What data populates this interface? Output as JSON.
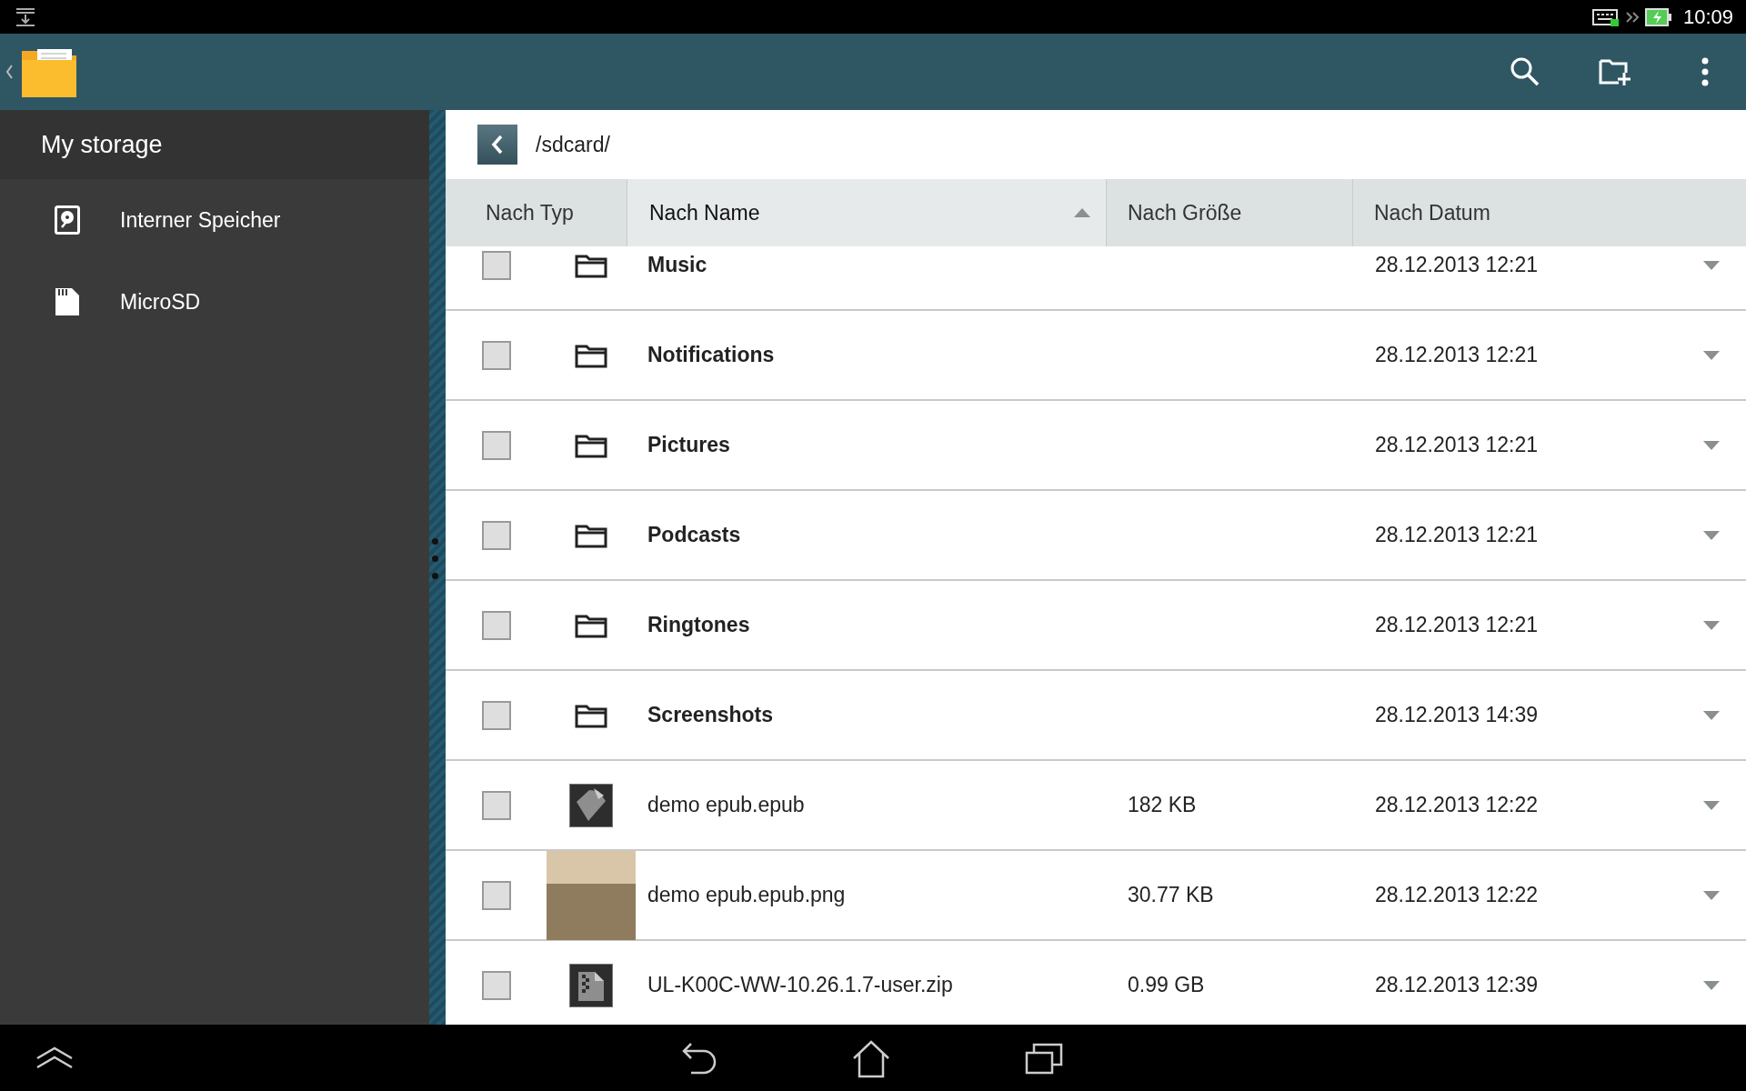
{
  "status_bar": {
    "time": "10:09"
  },
  "sidebar": {
    "title": "My storage",
    "items": [
      {
        "label": "Interner Speicher",
        "kind": "internal"
      },
      {
        "label": "MicroSD",
        "kind": "card"
      }
    ]
  },
  "path_bar": {
    "path": "/sdcard/"
  },
  "table": {
    "columns": [
      {
        "label": "Nach Typ",
        "selected": false
      },
      {
        "label": "Nach Name",
        "selected": true
      },
      {
        "label": "Nach Größe",
        "selected": false
      },
      {
        "label": "Nach Datum",
        "selected": false
      }
    ],
    "rows": [
      {
        "kind": "folder",
        "name": "Music",
        "size": "",
        "date": "28.12.2013 12:21",
        "checked": false
      },
      {
        "kind": "folder",
        "name": "Notifications",
        "size": "",
        "date": "28.12.2013 12:21",
        "checked": false
      },
      {
        "kind": "folder",
        "name": "Pictures",
        "size": "",
        "date": "28.12.2013 12:21",
        "checked": false
      },
      {
        "kind": "folder",
        "name": "Podcasts",
        "size": "",
        "date": "28.12.2013 12:21",
        "checked": false
      },
      {
        "kind": "folder",
        "name": "Ringtones",
        "size": "",
        "date": "28.12.2013 12:21",
        "checked": false
      },
      {
        "kind": "folder",
        "name": "Screenshots",
        "size": "",
        "date": "28.12.2013 14:39",
        "checked": false
      },
      {
        "kind": "document",
        "name": "demo epub.epub",
        "size": "182 KB",
        "date": "28.12.2013 12:22",
        "checked": false
      },
      {
        "kind": "image",
        "name": "demo epub.epub.png",
        "size": "30.77 KB",
        "date": "28.12.2013 12:22",
        "checked": false
      },
      {
        "kind": "archive",
        "name": "UL-K00C-WW-10.26.1.7-user.zip",
        "size": "0.99 GB",
        "date": "28.12.2013 12:39",
        "checked": false
      }
    ]
  }
}
